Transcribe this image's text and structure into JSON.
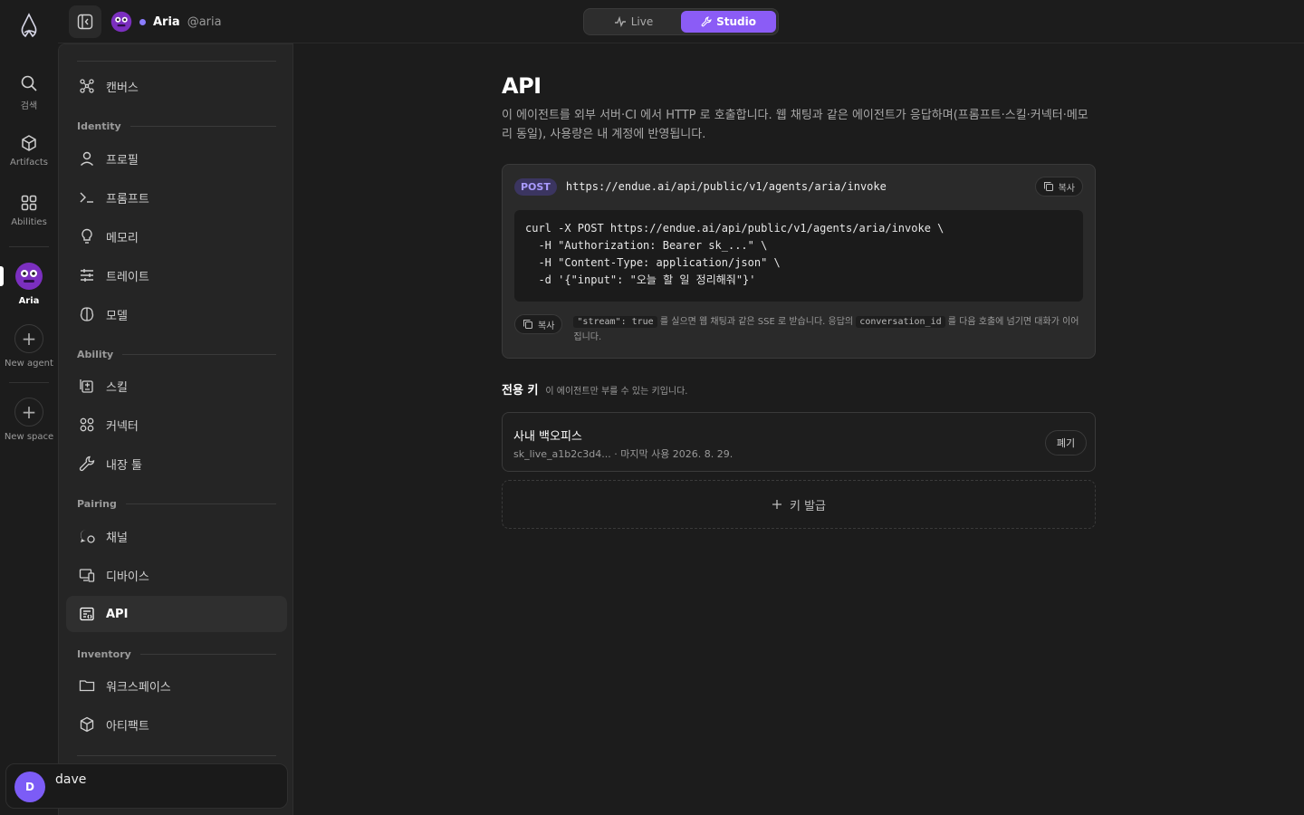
{
  "rail": {
    "items": [
      {
        "label": "검색",
        "icon": "search-icon"
      },
      {
        "label": "Artifacts",
        "icon": "cube-icon"
      },
      {
        "label": "Abilities",
        "icon": "grid-icon"
      },
      {
        "label": "Aria",
        "icon": "agent-avatar"
      },
      {
        "label": "New agent",
        "icon": "plus-icon"
      },
      {
        "label": "New space",
        "icon": "plus-icon"
      }
    ]
  },
  "topbar": {
    "agent_name": "Aria",
    "agent_handle": "@aria",
    "modes": [
      {
        "label": "Live",
        "icon": "activity-icon"
      },
      {
        "label": "Studio",
        "icon": "wrench-icon"
      }
    ],
    "active_mode": "Studio"
  },
  "sidebar": {
    "canvas": "캔버스",
    "sections": {
      "identity": "Identity",
      "ability": "Ability",
      "pairing": "Pairing",
      "inventory": "Inventory"
    },
    "items": {
      "profile": "프로필",
      "prompt": "프롬프트",
      "memory": "메모리",
      "traits": "트레이트",
      "model": "모델",
      "skills": "스킬",
      "connectors": "커넥터",
      "builtin_tools": "내장 툴",
      "channels": "채널",
      "devices": "디바이스",
      "api": "API",
      "workspace": "워크스페이스",
      "artifacts": "아티팩트"
    }
  },
  "user": {
    "initial": "D",
    "name": "dave"
  },
  "main": {
    "title": "API",
    "description": "이 에이전트를 외부 서버·CI 에서 HTTP 로 호출합니다. 웹 채팅과 같은 에이전트가 응답하며(프롬프트·스킬·커넥터·메모리 동일), 사용량은 내 계정에 반영됩니다.",
    "method": "POST",
    "endpoint": "https://endue.ai/api/public/v1/agents/aria/invoke",
    "copy_label": "복사",
    "code": "curl -X POST https://endue.ai/api/public/v1/agents/aria/invoke \\\n  -H \"Authorization: Bearer sk_...\" \\\n  -H \"Content-Type: application/json\" \\\n  -d '{\"input\": \"오늘 할 일 정리해줘\"}'",
    "note": {
      "code1": "\"stream\": true",
      "text1": " 를 실으면 웹 채팅과 같은 SSE 로 받습니다. 응답의 ",
      "code2": "conversation_id",
      "text2": " 를 다음 호출에 넘기면 대화가 이어집니다."
    },
    "keys_title": "전용 키",
    "keys_subtitle": "이 에이전트만 부를 수 있는 키입니다.",
    "keys": [
      {
        "name": "사내 백오피스",
        "meta": "sk_live_a1b2c3d4... · 마지막 사용 2026. 8. 29.",
        "revoke_label": "폐기"
      }
    ],
    "issue_label": "키 발급"
  },
  "colors": {
    "accent": "#8b5cf6",
    "background": "#1c1c1c",
    "panel": "#252525"
  }
}
